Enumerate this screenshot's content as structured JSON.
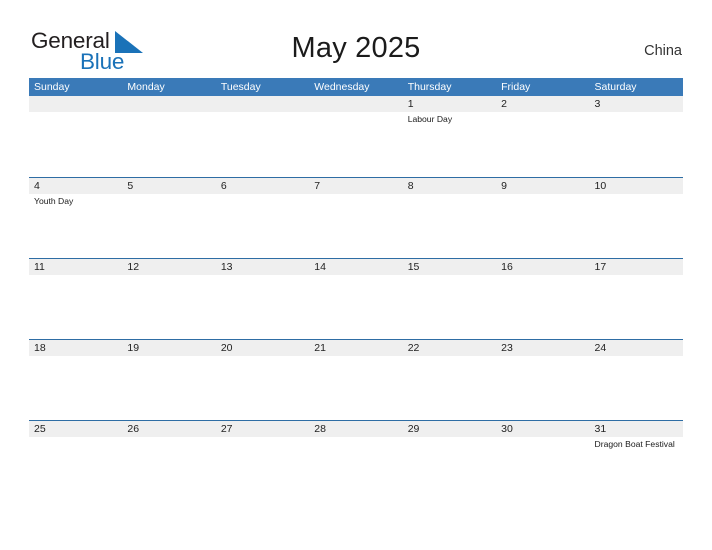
{
  "brand": {
    "name_part1": "General",
    "name_part2": "Blue",
    "accent_color": "#1a72b8"
  },
  "header": {
    "title": "May 2025",
    "region": "China"
  },
  "theme": {
    "header_blue": "#3a7ab8",
    "row_divider_blue": "#2e6da4",
    "date_band_gray": "#efefef"
  },
  "calendar": {
    "weekdays": [
      "Sunday",
      "Monday",
      "Tuesday",
      "Wednesday",
      "Thursday",
      "Friday",
      "Saturday"
    ],
    "weeks": [
      [
        {
          "date": "",
          "events": []
        },
        {
          "date": "",
          "events": []
        },
        {
          "date": "",
          "events": []
        },
        {
          "date": "",
          "events": []
        },
        {
          "date": "1",
          "events": [
            "Labour Day"
          ]
        },
        {
          "date": "2",
          "events": []
        },
        {
          "date": "3",
          "events": []
        }
      ],
      [
        {
          "date": "4",
          "events": [
            "Youth Day"
          ]
        },
        {
          "date": "5",
          "events": []
        },
        {
          "date": "6",
          "events": []
        },
        {
          "date": "7",
          "events": []
        },
        {
          "date": "8",
          "events": []
        },
        {
          "date": "9",
          "events": []
        },
        {
          "date": "10",
          "events": []
        }
      ],
      [
        {
          "date": "11",
          "events": []
        },
        {
          "date": "12",
          "events": []
        },
        {
          "date": "13",
          "events": []
        },
        {
          "date": "14",
          "events": []
        },
        {
          "date": "15",
          "events": []
        },
        {
          "date": "16",
          "events": []
        },
        {
          "date": "17",
          "events": []
        }
      ],
      [
        {
          "date": "18",
          "events": []
        },
        {
          "date": "19",
          "events": []
        },
        {
          "date": "20",
          "events": []
        },
        {
          "date": "21",
          "events": []
        },
        {
          "date": "22",
          "events": []
        },
        {
          "date": "23",
          "events": []
        },
        {
          "date": "24",
          "events": []
        }
      ],
      [
        {
          "date": "25",
          "events": []
        },
        {
          "date": "26",
          "events": []
        },
        {
          "date": "27",
          "events": []
        },
        {
          "date": "28",
          "events": []
        },
        {
          "date": "29",
          "events": []
        },
        {
          "date": "30",
          "events": []
        },
        {
          "date": "31",
          "events": [
            "Dragon Boat Festival"
          ]
        }
      ]
    ]
  }
}
